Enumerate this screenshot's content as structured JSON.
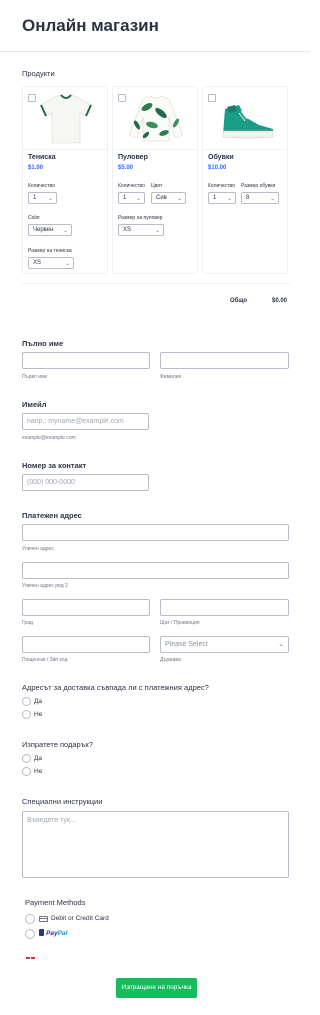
{
  "header": {
    "title": "Онлайн магазин"
  },
  "products": {
    "section_label": "Продукти",
    "items": [
      {
        "name": "Тениска",
        "price": "$1.00",
        "image": "white-tshirt-image",
        "options": [
          {
            "label": "Количество",
            "value": "1"
          },
          {
            "label": "Color",
            "value": "Червен"
          },
          {
            "label": "Размер на тениска",
            "value": "XS"
          }
        ]
      },
      {
        "name": "Пуловер",
        "price": "$5.00",
        "image": "floral-sweater-image",
        "options": [
          {
            "label": "Количество",
            "value": "1"
          },
          {
            "label": "Цвят",
            "value": "Сив"
          },
          {
            "label": "Размер на пуловер",
            "value": "XS"
          }
        ]
      },
      {
        "name": "Обувки",
        "price": "$10.00",
        "image": "sneaker-image",
        "options": [
          {
            "label": "Количество",
            "value": "1"
          },
          {
            "label": "Размер обувки",
            "value": "8"
          }
        ]
      }
    ],
    "total_label": "Общо",
    "total_value": "$0.00"
  },
  "full_name": {
    "label": "Пълно име",
    "first_sublabel": "Първо име",
    "last_sublabel": "Фамилия"
  },
  "email": {
    "label": "Имейл",
    "placeholder": "напр.: myname@example.com",
    "sublabel": "example@example.com"
  },
  "phone": {
    "label": "Номер за контакт",
    "placeholder": "(000) 000-0000"
  },
  "billing": {
    "label": "Платежен адрес",
    "street_sublabel": "Уличен адрес",
    "street2_sublabel": "Уличен адрес ред 2",
    "city_sublabel": "Град",
    "state_sublabel": "Щат / Провинция",
    "zip_sublabel": "Пощенски / Зип код",
    "country_placeholder": "Please Select",
    "country_sublabel": "Държава"
  },
  "same_address": {
    "question": "Адресът за доставка съвпада ли с платежния адрес?",
    "options": [
      "Да",
      "Не"
    ]
  },
  "gift": {
    "question": "Изпратете подарък?",
    "options": [
      "Да",
      "Не"
    ]
  },
  "instructions": {
    "label": "Специални инструкции",
    "placeholder": "Въведете тук..."
  },
  "payment": {
    "label": "Payment Methods",
    "card_label": "Debit or Credit Card",
    "paypal_part1": "Pay",
    "paypal_part2": "Pal"
  },
  "colors": {
    "accent_blue": "#2e69ff",
    "submit_green": "#18bd5b"
  },
  "submit": {
    "label": "Изпращане на поръчка"
  }
}
